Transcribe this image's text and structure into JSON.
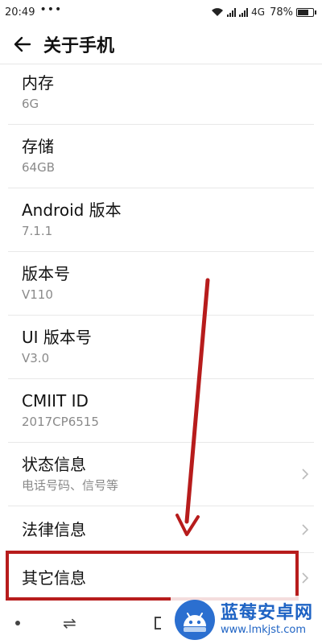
{
  "status_bar": {
    "time": "20:49",
    "dots": "•••",
    "network": "4G",
    "battery": "78%",
    "battery_level": 0.78
  },
  "header": {
    "title": "关于手机",
    "back_icon": "back-arrow-icon"
  },
  "items": [
    {
      "title": "内存",
      "subtitle": "6G",
      "chevron": false
    },
    {
      "title": "存储",
      "subtitle": "64GB",
      "chevron": false
    },
    {
      "title": "Android 版本",
      "subtitle": "7.1.1",
      "chevron": false
    },
    {
      "title": "版本号",
      "subtitle": "V110",
      "chevron": false
    },
    {
      "title": "UI 版本号",
      "subtitle": "V3.0",
      "chevron": false
    },
    {
      "title": "CMIIT ID",
      "subtitle": "2017CP6515",
      "chevron": false
    },
    {
      "title": "状态信息",
      "subtitle": "电话号码、信号等",
      "chevron": true
    },
    {
      "title": "法律信息",
      "subtitle": "",
      "chevron": true
    },
    {
      "title": "其它信息",
      "subtitle": "",
      "chevron": true
    }
  ],
  "annotation": {
    "highlight_color": "#b71c1c"
  },
  "nav_bar": {
    "swap_glyph": "⇌"
  },
  "watermark": {
    "title": "蓝莓安卓网",
    "url": "www.lmkjst.com"
  }
}
